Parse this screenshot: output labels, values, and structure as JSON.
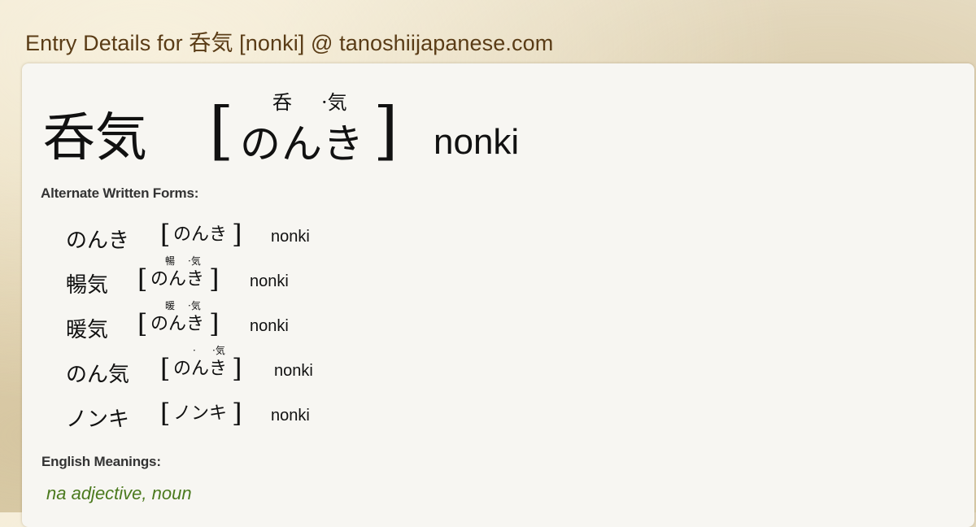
{
  "page": {
    "title": "Entry Details for 呑気 [nonki] @ tanoshiijapanese.com"
  },
  "entry": {
    "kanji": "呑気",
    "bracket_open": "[",
    "bracket_close": "]",
    "kana": "のんき",
    "furigana": [
      "呑",
      "·気"
    ],
    "romaji": "nonki"
  },
  "alternate_forms": {
    "label": "Alternate Written Forms:",
    "items": [
      {
        "word": "のんき",
        "kana": "のんき",
        "furigana_1": "",
        "furigana_2": "",
        "romaji": "nonki"
      },
      {
        "word": "暢気",
        "kana": "のんき",
        "furigana_1": "暢",
        "furigana_2": "·気",
        "romaji": "nonki"
      },
      {
        "word": "暖気",
        "kana": "のんき",
        "furigana_1": "暖",
        "furigana_2": "·気",
        "romaji": "nonki"
      },
      {
        "word": "のん気",
        "kana": "のんき",
        "furigana_1": "·",
        "furigana_2": "·気",
        "romaji": "nonki"
      },
      {
        "word": "ノンキ",
        "kana": "ノンキ",
        "furigana_1": "",
        "furigana_2": "",
        "romaji": "nonki"
      }
    ]
  },
  "meanings": {
    "label": "English Meanings:",
    "pos": "na adjective, noun"
  },
  "colors": {
    "title": "#5a3c16",
    "meaning": "#4b7a1e",
    "card_bg": "#f7f6f2"
  }
}
